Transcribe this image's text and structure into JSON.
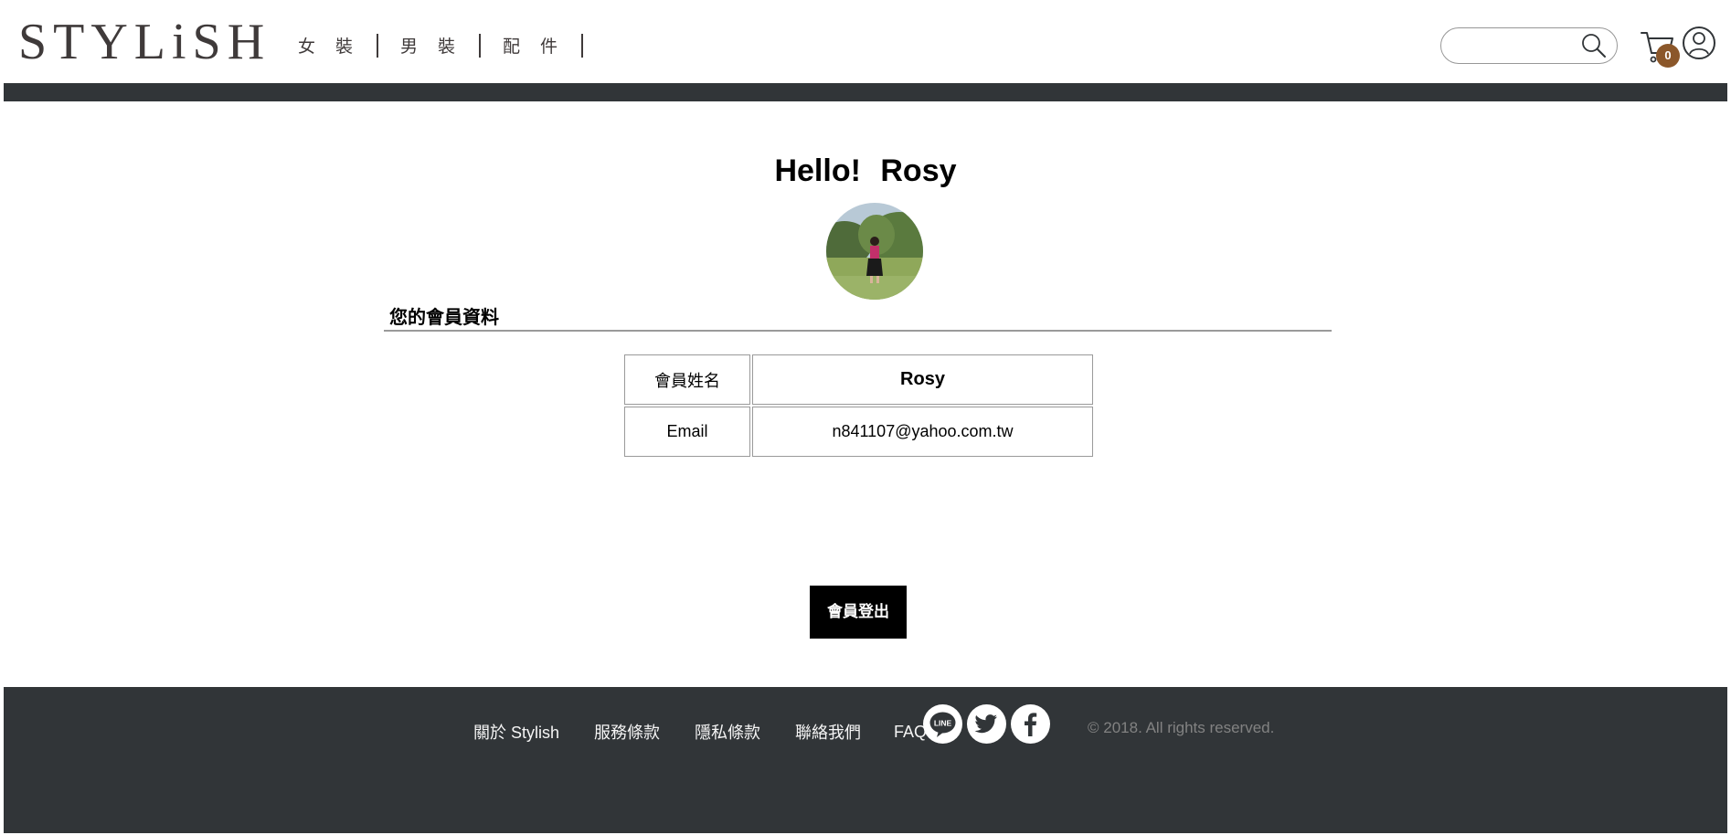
{
  "header": {
    "logo": "STYLiSH",
    "nav": [
      "女裝",
      "男裝",
      "配件"
    ],
    "search_placeholder": "",
    "cart_count": "0"
  },
  "profile": {
    "greeting": "Hello!",
    "name": "Rosy",
    "section_title": "您的會員資料",
    "rows": [
      {
        "label": "會員姓名",
        "value": "Rosy"
      },
      {
        "label": "Email",
        "value": "n841107@yahoo.com.tw"
      }
    ],
    "logout_label": "會員登出"
  },
  "footer": {
    "links": [
      "關於 Stylish",
      "服務條款",
      "隱私條款",
      "聯絡我們",
      "FAQ"
    ],
    "socials": [
      "line-icon",
      "twitter-icon",
      "facebook-icon"
    ],
    "copyright": "© 2018. All rights reserved."
  },
  "colors": {
    "dark_bar": "#313538",
    "badge": "#8b572a",
    "logo_text": "#3f3a3a"
  }
}
